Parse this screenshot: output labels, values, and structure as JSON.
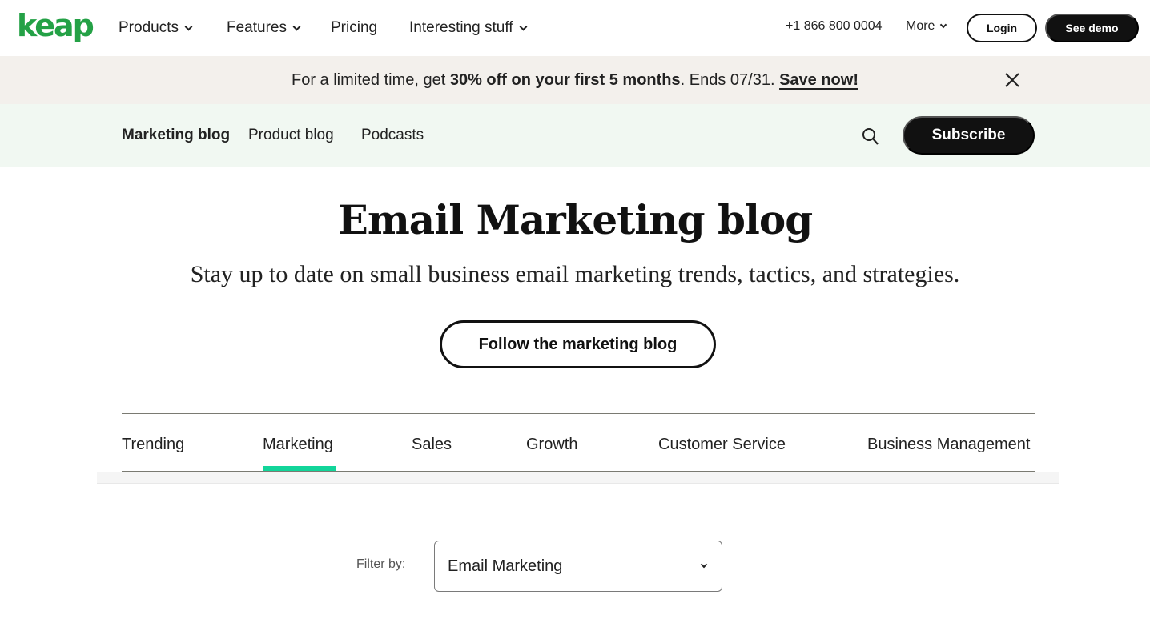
{
  "brand": {
    "logo_text": "keap",
    "logo_color": "#24a146"
  },
  "topnav": {
    "items": [
      {
        "label": "Products",
        "has_dropdown": true
      },
      {
        "label": "Features",
        "has_dropdown": true
      },
      {
        "label": "Pricing",
        "has_dropdown": false
      },
      {
        "label": "Interesting stuff",
        "has_dropdown": true
      }
    ],
    "phone": "+1 866 800 0004",
    "more_label": "More",
    "login_label": "Login",
    "demo_label": "See demo"
  },
  "promo": {
    "text_before": "For a limited time, get ",
    "text_bold": "30% off on your first 5 months",
    "text_after": ". Ends 07/31. ",
    "link_label": "Save now!",
    "close_icon": "close-icon"
  },
  "subnav": {
    "items": [
      {
        "label": "Marketing blog",
        "active": true
      },
      {
        "label": "Product blog",
        "active": false
      },
      {
        "label": "Podcasts",
        "active": false
      }
    ],
    "search_icon": "search-icon",
    "subscribe_label": "Subscribe"
  },
  "hero": {
    "title": "Email Marketing blog",
    "subtitle": "Stay up to date on small business email marketing trends, tactics, and strategies.",
    "follow_label": "Follow the marketing blog"
  },
  "tabs": {
    "items": [
      {
        "label": "Trending",
        "active": false
      },
      {
        "label": "Marketing",
        "active": true
      },
      {
        "label": "Sales",
        "active": false
      },
      {
        "label": "Growth",
        "active": false
      },
      {
        "label": "Customer Service",
        "active": false
      },
      {
        "label": "Business Management",
        "active": false
      }
    ],
    "accent_color": "#12d59a"
  },
  "filter": {
    "label": "Filter by:",
    "selected": "Email Marketing"
  }
}
